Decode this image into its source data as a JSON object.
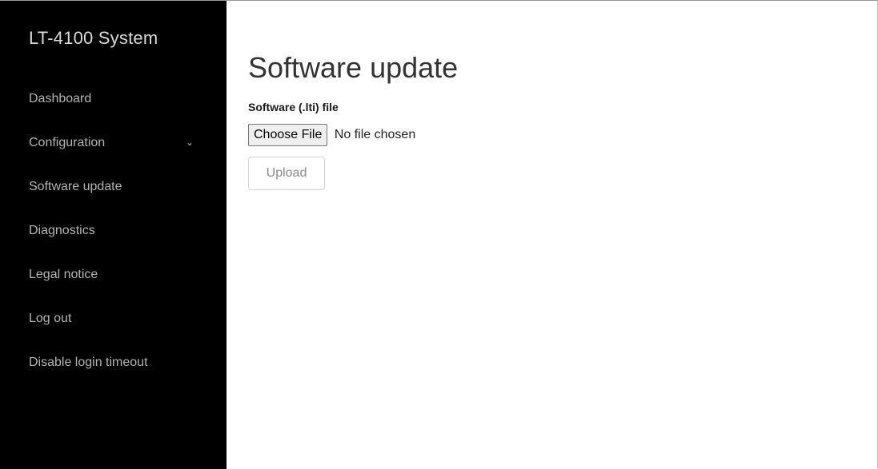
{
  "sidebar": {
    "brand": "LT-4100 System",
    "items": [
      {
        "label": "Dashboard"
      },
      {
        "label": "Configuration",
        "chevron": "⌄"
      },
      {
        "label": "Software update"
      },
      {
        "label": "Diagnostics"
      },
      {
        "label": "Legal notice"
      },
      {
        "label": "Log out"
      },
      {
        "label": "Disable login timeout"
      }
    ]
  },
  "main": {
    "title": "Software update",
    "field_label": "Software (.lti) file",
    "choose_file_label": "Choose File",
    "no_file_text": "No file chosen",
    "upload_label": "Upload"
  },
  "colors": {
    "sidebar_bg": "#000000",
    "sidebar_text": "#b3b3b3",
    "upload_disabled_text": "#8a8a8a"
  }
}
